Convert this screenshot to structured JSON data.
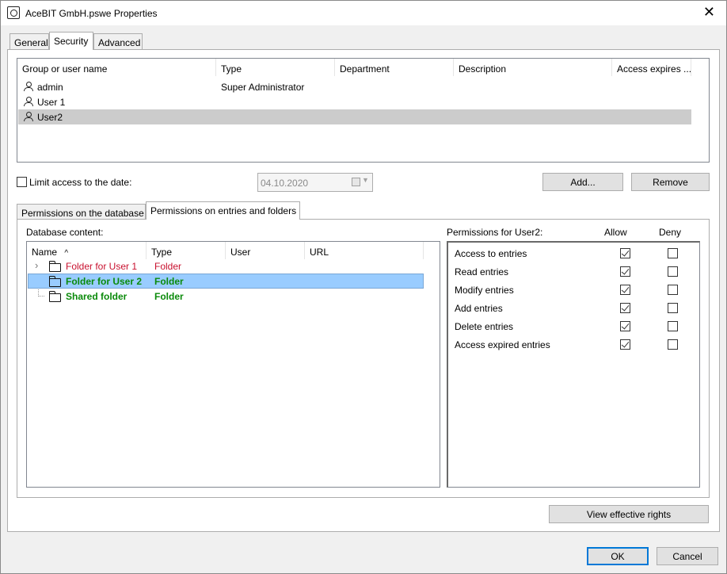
{
  "window": {
    "title": "AceBIT GmbH.pswe Properties"
  },
  "tabs": [
    {
      "label": "General"
    },
    {
      "label": "Security"
    },
    {
      "label": "Advanced"
    }
  ],
  "users_table": {
    "columns": [
      "Group or user name",
      "Type",
      "Department",
      "Description",
      "Access expires ..."
    ],
    "rows": [
      {
        "name": "admin",
        "type": "Super Administrator"
      },
      {
        "name": "User 1",
        "type": ""
      },
      {
        "name": "User2",
        "type": ""
      }
    ]
  },
  "limit": {
    "label": "Limit access to the date:",
    "date": "04.10.2020"
  },
  "buttons": {
    "add": "Add...",
    "remove": "Remove",
    "view_rights": "View effective rights",
    "ok": "OK",
    "cancel": "Cancel"
  },
  "subtabs": [
    {
      "label": "Permissions on the database"
    },
    {
      "label": "Permissions on entries and folders"
    }
  ],
  "content": {
    "label": "Database content:",
    "columns": [
      "Name",
      "Type",
      "User",
      "URL"
    ],
    "rows": [
      {
        "name": "Folder for User 1",
        "type": "Folder"
      },
      {
        "name": "Folder for User 2",
        "type": "Folder"
      },
      {
        "name": "Shared folder",
        "type": "Folder"
      }
    ]
  },
  "permissions": {
    "label": "Permissions for User2:",
    "allow_label": "Allow",
    "deny_label": "Deny",
    "items": [
      {
        "label": "Access to entries",
        "allow": true,
        "deny": false
      },
      {
        "label": "Read entries",
        "allow": true,
        "deny": false
      },
      {
        "label": "Modify entries",
        "allow": true,
        "deny": false
      },
      {
        "label": "Add entries",
        "allow": true,
        "deny": false
      },
      {
        "label": "Delete entries",
        "allow": true,
        "deny": false
      },
      {
        "label": "Access expired entries",
        "allow": true,
        "deny": false
      }
    ]
  },
  "colors": {
    "selected_row": "#cccccc",
    "selected_tree_row": "#99ccff",
    "accent": "#0078d7"
  }
}
